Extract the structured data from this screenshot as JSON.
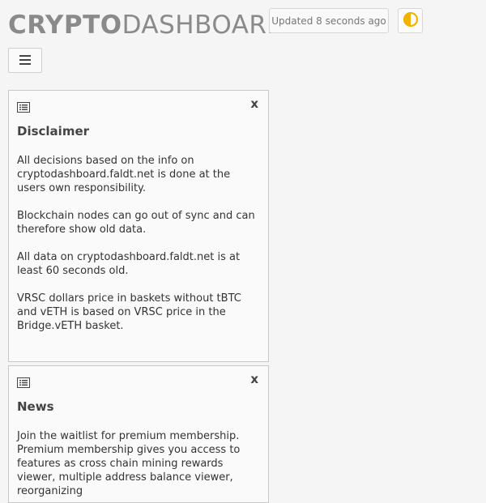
{
  "header": {
    "logo_bold": "CRYPTO",
    "logo_light": "DASHBOARD",
    "updated_text": "Updated 8 seconds ago",
    "theme_icon": "half-circle-theme-icon",
    "menu_icon": "hamburger-icon"
  },
  "cards": {
    "disclaimer": {
      "icon": "list-card-icon",
      "close": "x",
      "title": "Disclaimer",
      "paragraphs": [
        "All decisions based on the info on cryptodashboard.faldt.net is done at the users own responsibility.",
        "Blockchain nodes can go out of sync and can therefore show old data.",
        "All data on cryptodashboard.faldt.net is at least 60 seconds old.",
        "VRSC dollars price in baskets without tBTC and vETH is based on VRSC price in the Bridge.vETH basket."
      ]
    },
    "news": {
      "icon": "list-card-icon",
      "close": "x",
      "title": "News",
      "paragraphs": [
        "Join the waitlist for premium membership. Premium membership gives you access to features as cross chain mining rewards viewer, multiple address balance viewer, reorganizing"
      ]
    }
  },
  "colors": {
    "logo": "#8a8a8a",
    "theme_icon": "#f0b400",
    "background": "#f5f5f5"
  }
}
